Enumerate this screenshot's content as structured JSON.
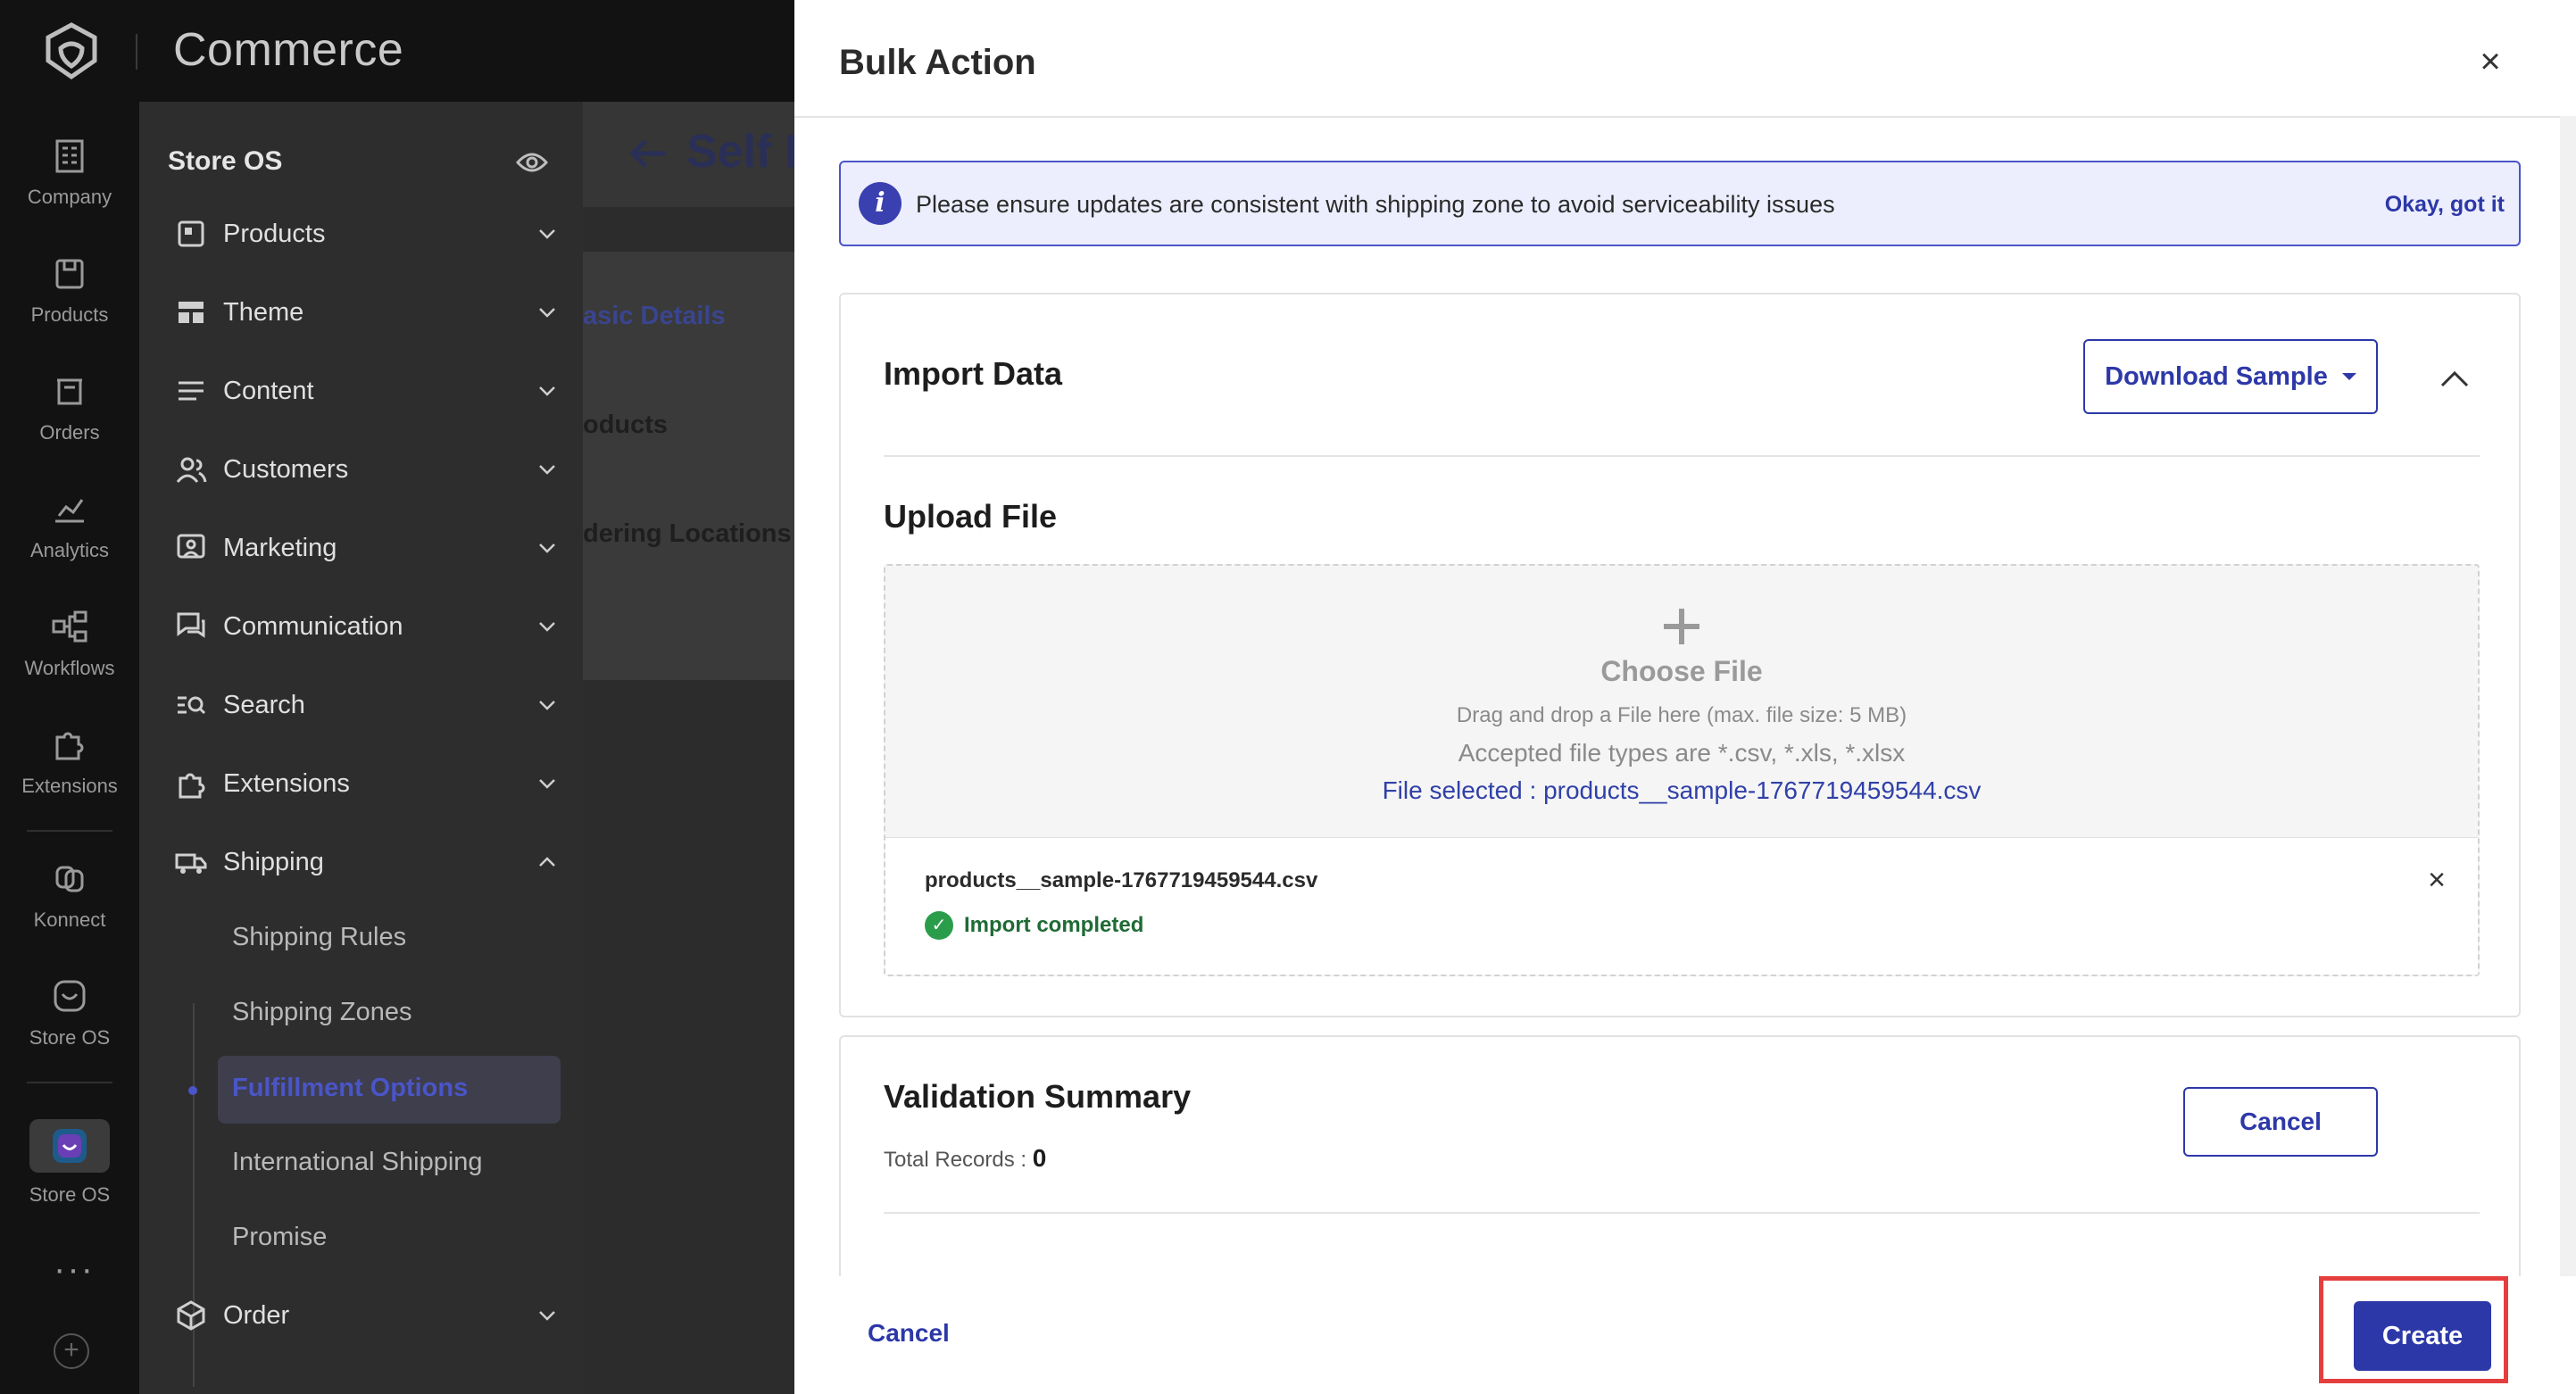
{
  "app": {
    "brand": "Commerce"
  },
  "rail": {
    "items": [
      {
        "label": "Company",
        "icon": "building-icon"
      },
      {
        "label": "Products",
        "icon": "box-icon"
      },
      {
        "label": "Orders",
        "icon": "basket-icon"
      },
      {
        "label": "Analytics",
        "icon": "chart-icon"
      },
      {
        "label": "Workflows",
        "icon": "workflow-icon"
      },
      {
        "label": "Extensions",
        "icon": "puzzle-icon"
      },
      {
        "label": "Konnect",
        "icon": "link-icon"
      },
      {
        "label": "Store OS",
        "icon": "store-os-icon"
      },
      {
        "label": "Store OS",
        "icon": "store-os-app-icon"
      }
    ],
    "more": "···",
    "add": "+"
  },
  "sidebar": {
    "title": "Store OS",
    "items": [
      {
        "label": "Products",
        "icon": "products-icon"
      },
      {
        "label": "Theme",
        "icon": "theme-icon"
      },
      {
        "label": "Content",
        "icon": "content-icon"
      },
      {
        "label": "Customers",
        "icon": "customers-icon"
      },
      {
        "label": "Marketing",
        "icon": "marketing-icon"
      },
      {
        "label": "Communication",
        "icon": "communication-icon"
      },
      {
        "label": "Search",
        "icon": "search-icon"
      },
      {
        "label": "Extensions",
        "icon": "extensions-icon"
      },
      {
        "label": "Shipping",
        "icon": "truck-icon"
      },
      {
        "label": "Order",
        "icon": "order-icon"
      }
    ],
    "shipping_sub": [
      "Shipping Rules",
      "Shipping Zones",
      "Fulfillment Options",
      "International Shipping",
      "Promise"
    ]
  },
  "background_page": {
    "title": "Self F",
    "links": [
      "asic Details",
      "oducts",
      "dering Locations"
    ]
  },
  "modal": {
    "title": "Bulk Action",
    "close": "×",
    "banner": {
      "message": "Please ensure updates are consistent with shipping zone to avoid serviceability issues",
      "action": "Okay, got it",
      "info_glyph": "i"
    },
    "import": {
      "heading": "Import Data",
      "download_label": "Download Sample",
      "upload_heading": "Upload File",
      "choose_file": "Choose File",
      "drag_hint": "Drag and drop a File here (max. file size: 5 MB)",
      "accepted_types": "Accepted file types are *.csv, *.xls, *.xlsx",
      "file_selected": "File selected : products__sample-1767719459544.csv",
      "file_name": "products__sample-1767719459544.csv",
      "status": "Import completed",
      "remove": "×"
    },
    "validation": {
      "heading": "Validation Summary",
      "total_label": "Total Records : ",
      "total_value": "0",
      "cancel_label": "Cancel"
    },
    "footer": {
      "cancel_label": "Cancel",
      "create_label": "Create"
    }
  },
  "colors": {
    "accent": "#2d38a8",
    "highlight_box": "#e53e3e",
    "success": "#2a9d4a",
    "banner_bg": "#eceefd"
  }
}
